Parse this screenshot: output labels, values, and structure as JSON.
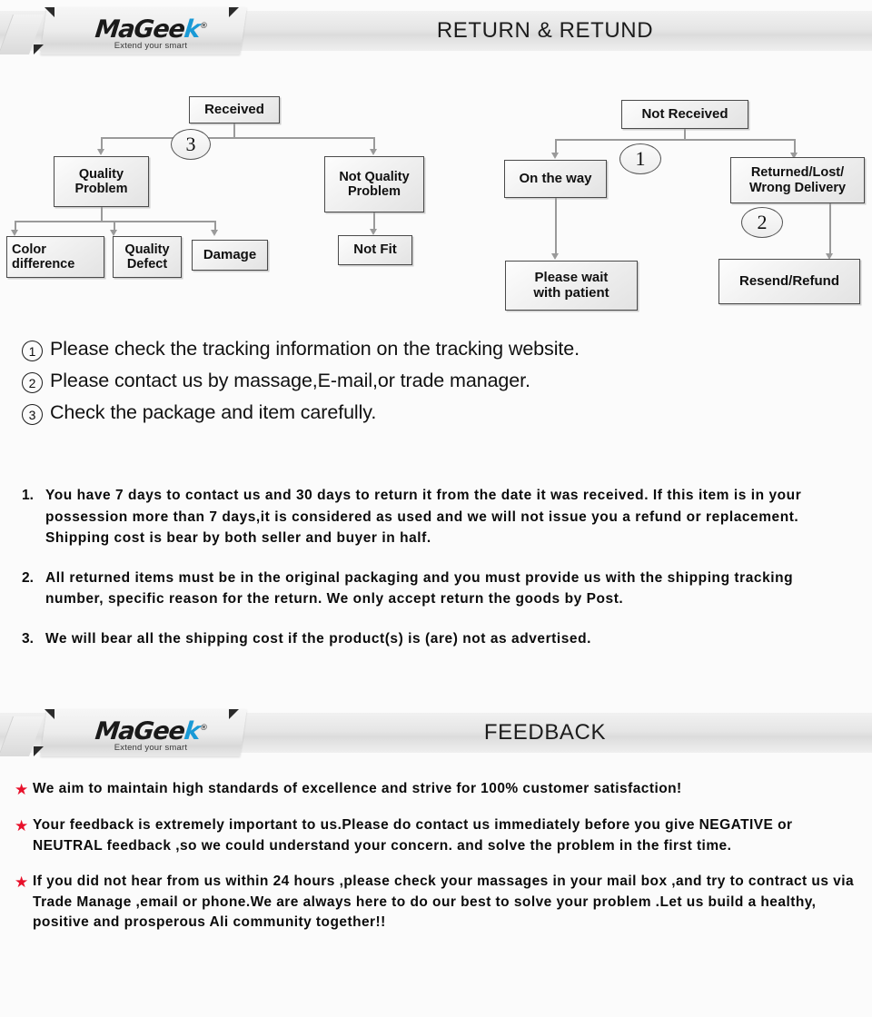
{
  "banners": [
    {
      "brand_name_a": "MaGee",
      "brand_name_k": "k",
      "brand_reg": "®",
      "tagline": "Extend your smart",
      "title": "RETURN & RETUND"
    },
    {
      "brand_name_a": "MaGee",
      "brand_name_k": "k",
      "brand_reg": "®",
      "tagline": "Extend your smart",
      "title": "FEEDBACK"
    }
  ],
  "flowchart": {
    "left": {
      "root": "Received",
      "marker": "3",
      "branch_a": "Quality\nProblem",
      "branch_b": "Not Quality\nProblem",
      "leaf_a1": "Color\ndifference",
      "leaf_a2": "Quality\nDefect",
      "leaf_a3": "Damage",
      "leaf_b1": "Not Fit"
    },
    "right": {
      "root": "Not  Received",
      "marker_1": "1",
      "marker_2": "2",
      "branch_a": "On the way",
      "branch_b": "Returned/Lost/\nWrong Delivery",
      "leaf_a1": "Please wait\nwith patient",
      "leaf_b1": "Resend/Refund"
    }
  },
  "notes": [
    {
      "num": "1",
      "text": "Please check the tracking information on the tracking website."
    },
    {
      "num": "2",
      "text": "Please contact us by  massage,E-mail,or trade manager."
    },
    {
      "num": "3",
      "text": "Check the package and item carefully."
    }
  ],
  "policy": [
    {
      "num": "1.",
      "text": "You have 7 days to contact us and 30 days to return it from the date it was received. If this item is in your possession more than 7 days,it is considered as used and we will not issue you a refund or replacement. Shipping cost is bear by both seller and buyer in half."
    },
    {
      "num": "2.",
      "text": "All returned items must be in the original packaging and you must provide us with the shipping tracking number, specific reason for the return. We only accept return the goods by Post."
    },
    {
      "num": "3.",
      "text": "We will bear all the shipping cost if the product(s) is (are) not as advertised."
    }
  ],
  "feedback": [
    {
      "star": "★",
      "text": "We aim to maintain high standards of excellence and strive  for 100% customer satisfaction!"
    },
    {
      "star": "★",
      "text": "Your feedback is extremely important to us.Please do contact us immediately before you give NEGATIVE or NEUTRAL feedback ,so  we could understand your concern. and solve the problem in the first time."
    },
    {
      "star": "★",
      "text": "If you did not hear from us within 24 hours ,please check your massages in your mail box ,and try to contract us via Trade Manage ,email or phone.We are always here to do our best to solve your problem .Let us build a healthy, positive and prosperous Ali community together!!"
    }
  ],
  "colors": {
    "page_background": "#fbfbfb",
    "banner_gray": "#e6e6e6",
    "star_red": "#e8102a",
    "logo_accent_blue": "#1a9ad6",
    "box_border": "#4a4a4a",
    "connector_gray": "#9a9a9a"
  }
}
